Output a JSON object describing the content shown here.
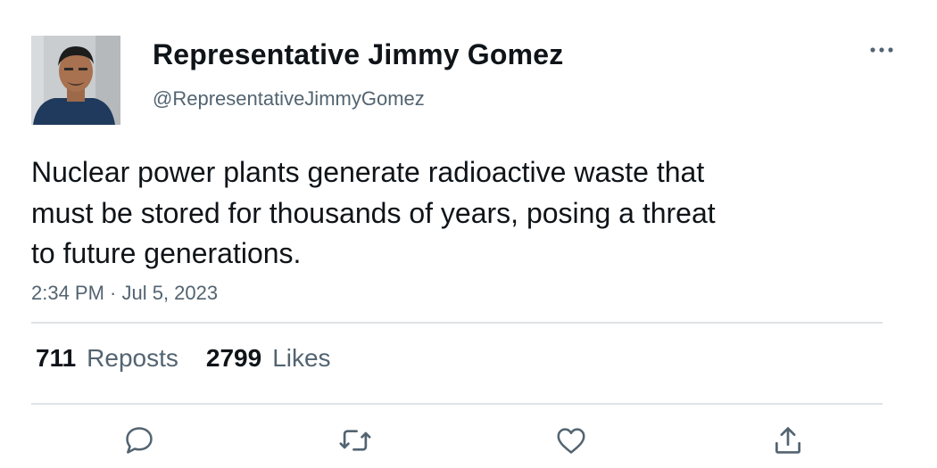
{
  "author": {
    "display_name": "Representative Jimmy Gomez",
    "handle": "@RepresentativeJimmyGomez"
  },
  "tweet": {
    "text_lines": [
      "Nuclear power plants generate radioactive waste that",
      "must be stored for thousands of years, posing a threat",
      "to future generations."
    ],
    "timestamp": "2:34 PM · Jul 5, 2023"
  },
  "stats": {
    "reposts_count": "711",
    "reposts_label": "Reposts",
    "likes_count": "2799",
    "likes_label": "Likes"
  },
  "icons": {
    "more": "more-dots-icon",
    "reply": "reply-icon",
    "repost": "repost-icon",
    "like": "like-icon",
    "share": "share-icon"
  },
  "colors": {
    "text": "#0f1419",
    "secondary_text": "#536471",
    "divider": "#dfe3e6",
    "background": "#ffffff"
  }
}
